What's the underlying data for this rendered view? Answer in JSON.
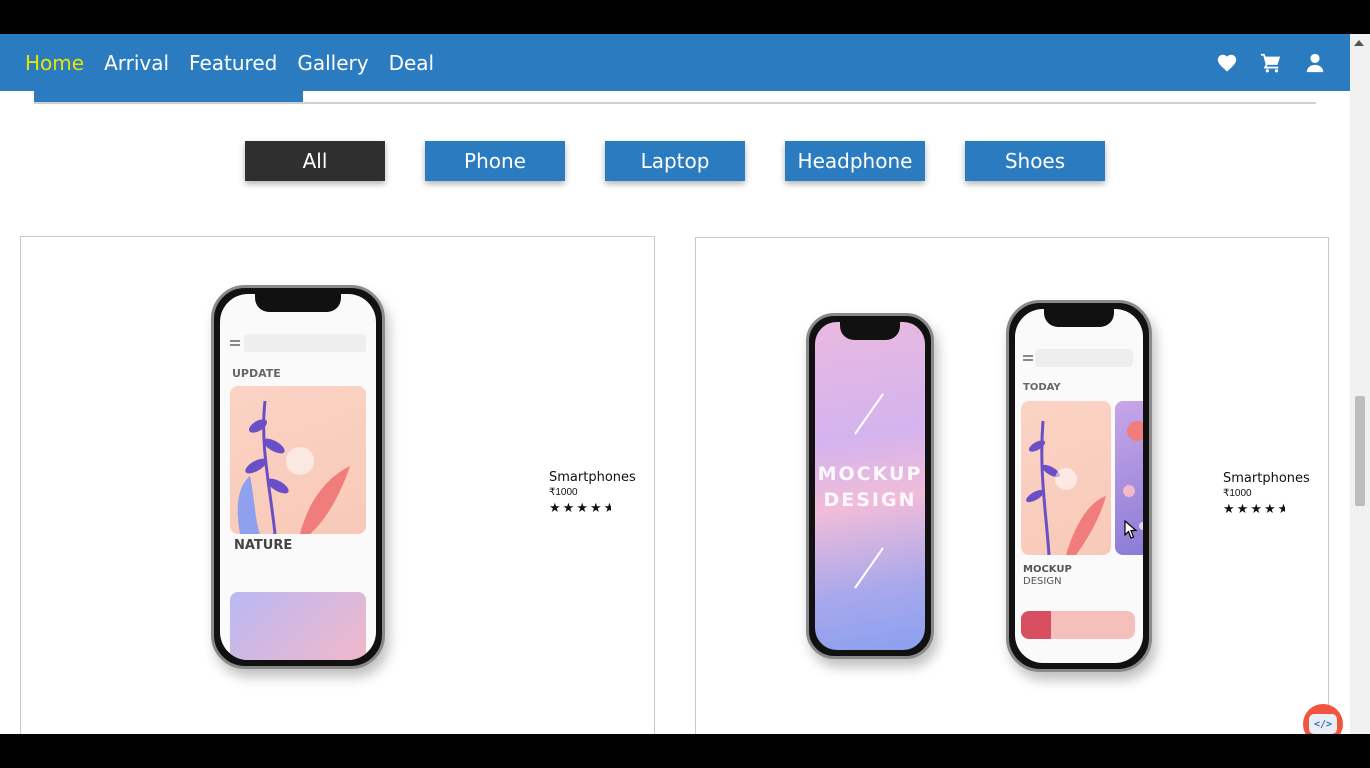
{
  "nav": {
    "links": [
      "Home",
      "Arrival",
      "Featured",
      "Gallery",
      "Deal"
    ],
    "active": "Home",
    "icons": [
      "heart-icon",
      "cart-icon",
      "user-icon"
    ]
  },
  "filters": {
    "items": [
      "All",
      "Phone",
      "Laptop",
      "Headphone",
      "Shoes"
    ],
    "active": "All"
  },
  "products": [
    {
      "title": "Smartphones",
      "price": "₹1000",
      "rating": 4.5,
      "screen_labels": {
        "top": "UPDATE",
        "card": "NATURE"
      }
    },
    {
      "title": "Smartphones",
      "price": "₹1000",
      "rating": 4.5,
      "screen_labels": {
        "left": "MOCKUP\nDESIGN",
        "top": "TODAY",
        "card_line1": "MOCKUP",
        "card_line2": "DESIGN"
      }
    }
  ],
  "colors": {
    "navbar": "#2a7bbf",
    "nav_active": "#e6e600",
    "filter_active": "#2f2f2f",
    "filter": "#2a7bbf"
  },
  "code_badge": "</>"
}
